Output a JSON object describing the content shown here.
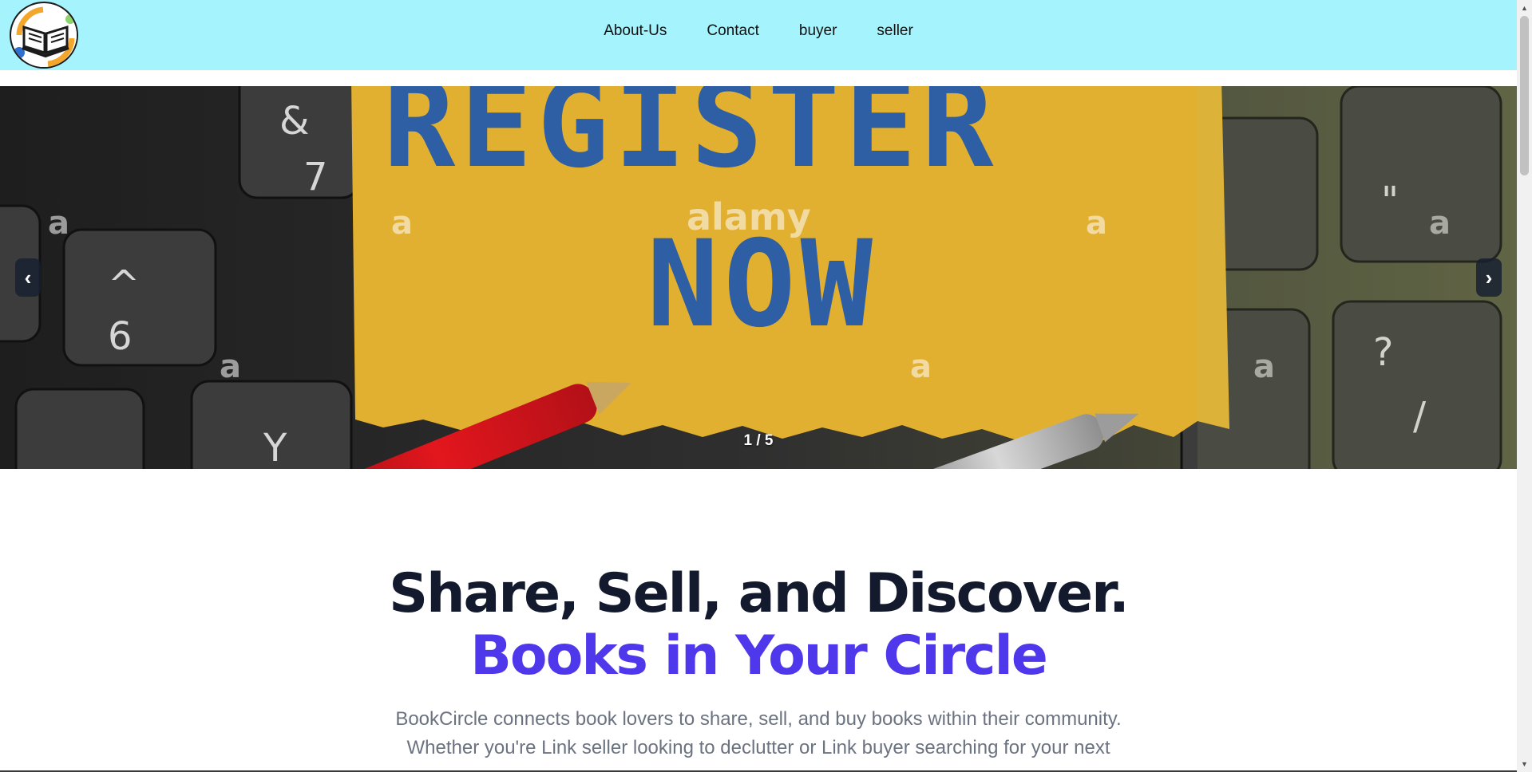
{
  "header": {
    "nav": [
      {
        "label": "About-Us"
      },
      {
        "label": "Contact"
      },
      {
        "label": "buyer"
      },
      {
        "label": "seller"
      }
    ]
  },
  "carousel": {
    "prev_symbol": "‹",
    "next_symbol": "›",
    "counter": "1 / 5",
    "slide": {
      "line1": "REGISTER",
      "line2": "NOW",
      "watermark": "alamy"
    }
  },
  "hero": {
    "title_line1": "Share, Sell, and Discover.",
    "title_line2": "Books in Your Circle",
    "description": "BookCircle connects book lovers to share, sell, and buy books within their community. Whether you're Link seller looking to declutter or Link buyer searching for your next"
  },
  "colors": {
    "header_bg": "#a5f3fc",
    "title_dark": "#141a2e",
    "title_accent": "#4f38eb",
    "body_text": "#6b7280"
  }
}
